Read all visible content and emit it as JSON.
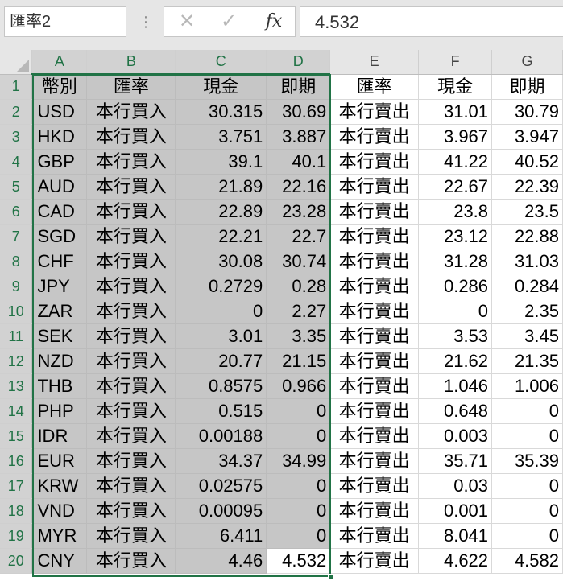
{
  "formula_bar": {
    "name_box": "匯率2",
    "cancel_icon": "✕",
    "enter_icon": "✓",
    "fx_label": "fx",
    "formula_value": "4.532"
  },
  "columns": [
    "A",
    "B",
    "C",
    "D",
    "E",
    "F",
    "G"
  ],
  "selected_columns": [
    "A",
    "B",
    "C",
    "D"
  ],
  "header_row": [
    "幣別",
    "匯率",
    "現金",
    "即期",
    "匯率",
    "現金",
    "即期"
  ],
  "rows": [
    [
      "USD",
      "本行買入",
      "30.315",
      "30.69",
      "本行賣出",
      "31.01",
      "30.79"
    ],
    [
      "HKD",
      "本行買入",
      "3.751",
      "3.887",
      "本行賣出",
      "3.967",
      "3.947"
    ],
    [
      "GBP",
      "本行買入",
      "39.1",
      "40.1",
      "本行賣出",
      "41.22",
      "40.52"
    ],
    [
      "AUD",
      "本行買入",
      "21.89",
      "22.16",
      "本行賣出",
      "22.67",
      "22.39"
    ],
    [
      "CAD",
      "本行買入",
      "22.89",
      "23.28",
      "本行賣出",
      "23.8",
      "23.5"
    ],
    [
      "SGD",
      "本行買入",
      "22.21",
      "22.7",
      "本行賣出",
      "23.12",
      "22.88"
    ],
    [
      "CHF",
      "本行買入",
      "30.08",
      "30.74",
      "本行賣出",
      "31.28",
      "31.03"
    ],
    [
      "JPY",
      "本行買入",
      "0.2729",
      "0.28",
      "本行賣出",
      "0.286",
      "0.284"
    ],
    [
      "ZAR",
      "本行買入",
      "0",
      "2.27",
      "本行賣出",
      "0",
      "2.35"
    ],
    [
      "SEK",
      "本行買入",
      "3.01",
      "3.35",
      "本行賣出",
      "3.53",
      "3.45"
    ],
    [
      "NZD",
      "本行買入",
      "20.77",
      "21.15",
      "本行賣出",
      "21.62",
      "21.35"
    ],
    [
      "THB",
      "本行買入",
      "0.8575",
      "0.966",
      "本行賣出",
      "1.046",
      "1.006"
    ],
    [
      "PHP",
      "本行買入",
      "0.515",
      "0",
      "本行賣出",
      "0.648",
      "0"
    ],
    [
      "IDR",
      "本行買入",
      "0.00188",
      "0",
      "本行賣出",
      "0.003",
      "0"
    ],
    [
      "EUR",
      "本行買入",
      "34.37",
      "34.99",
      "本行賣出",
      "35.71",
      "35.39"
    ],
    [
      "KRW",
      "本行買入",
      "0.02575",
      "0",
      "本行賣出",
      "0.03",
      "0"
    ],
    [
      "VND",
      "本行買入",
      "0.00095",
      "0",
      "本行賣出",
      "0.001",
      "0"
    ],
    [
      "MYR",
      "本行買入",
      "6.411",
      "0",
      "本行賣出",
      "8.041",
      "0"
    ],
    [
      "CNY",
      "本行買入",
      "4.46",
      "4.532",
      "本行賣出",
      "4.622",
      "4.582"
    ]
  ],
  "active_cell": "D20",
  "colors": {
    "accent": "#217346",
    "selection_fill": "#c6c6c6",
    "header_bg": "#e6e6e6"
  }
}
